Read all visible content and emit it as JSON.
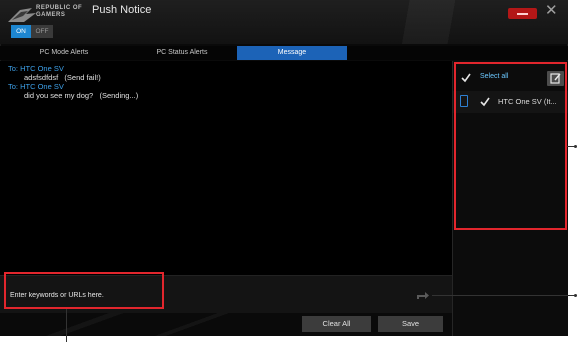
{
  "header": {
    "brand_line1": "REPUBLIC OF",
    "brand_line2": "GAMERS",
    "title": "Push Notice",
    "toggle_on": "ON",
    "toggle_off": "OFF",
    "close_glyph": "✕"
  },
  "tabs": [
    {
      "label": "PC Mode Alerts",
      "active": false
    },
    {
      "label": "PC Status Alerts",
      "active": false
    },
    {
      "label": "Message",
      "active": true
    }
  ],
  "messages": [
    {
      "to": "To: HTC One SV",
      "body": "adsfsdfdsf   (Send fail!)"
    },
    {
      "to": "To: HTC One SV",
      "body": "did you see my dog?   (Sending...)"
    }
  ],
  "device_panel": {
    "select_all_label": "Select all",
    "devices": [
      {
        "name": "HTC One SV (It...",
        "checked": true
      }
    ]
  },
  "input": {
    "placeholder": "Enter keywords or URLs here."
  },
  "buttons": {
    "clear_all": "Clear All",
    "save": "Save"
  },
  "colors": {
    "accent_blue": "#1c63b7",
    "annotation_red": "#e2262d",
    "rog_red": "#b31717"
  }
}
